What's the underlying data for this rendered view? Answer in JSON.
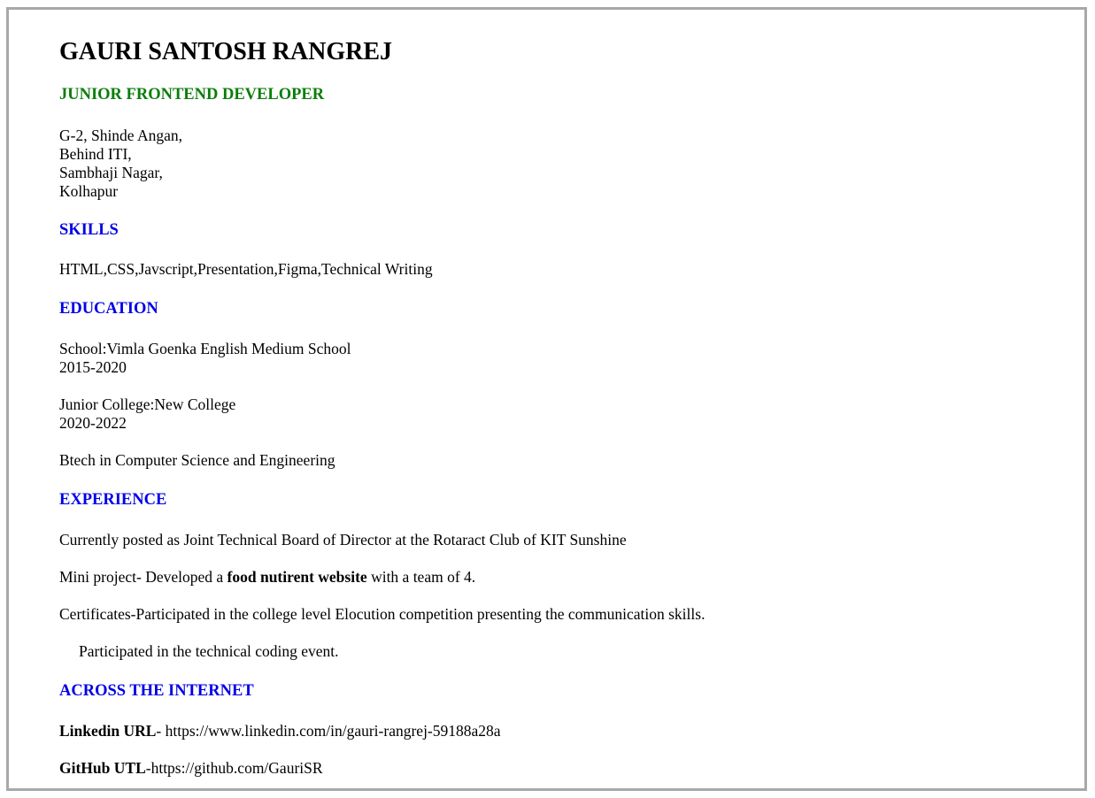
{
  "name": "GAURI SANTOSH RANGREJ",
  "role": "JUNIOR FRONTEND DEVELOPER",
  "address": [
    "G-2, Shinde Angan,",
    "Behind ITI,",
    "Sambhaji Nagar,",
    "Kolhapur"
  ],
  "skills": {
    "heading": "SKILLS",
    "text": "HTML,CSS,Javscript,Presentation,Figma,Technical Writing"
  },
  "education": {
    "heading": "EDUCATION",
    "school": {
      "label": "School:Vimla Goenka English Medium School",
      "years": "2015-2020"
    },
    "junior_college": {
      "label": "Junior College:New College",
      "years": "2020-2022"
    },
    "degree": "Btech in Computer Science and Engineering"
  },
  "experience": {
    "heading": "EXPERIENCE",
    "current": "Currently posted as Joint Technical Board of Director at the Rotaract Club of KIT Sunshine",
    "mini_prefix": "Mini project- Developed a ",
    "mini_bold": "food nutirent website",
    "mini_suffix": " with a team of 4.",
    "certificates": "Certificates-Participated in the college level Elocution competition presenting the communication skills.",
    "participated": "Participated in the technical coding event."
  },
  "internet": {
    "heading": "ACROSS THE INTERNET",
    "linkedin_label": "Linkedin URL",
    "linkedin_value": "- https://www.linkedin.com/in/gauri-rangrej-59188a28a",
    "github_label": "GitHub UTL",
    "github_value": "-https://github.com/GauriSR"
  }
}
